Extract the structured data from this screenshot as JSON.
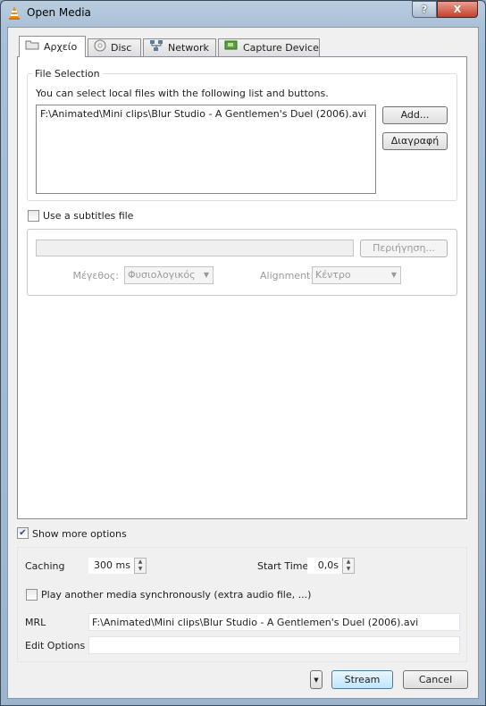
{
  "window": {
    "title": "Open Media",
    "help_label": "?",
    "close_label": "X"
  },
  "tabs": [
    {
      "label": "Αρχείο",
      "icon": "folder-icon"
    },
    {
      "label": "Disc",
      "icon": "disc-icon"
    },
    {
      "label": "Network",
      "icon": "network-icon"
    },
    {
      "label": "Capture Device",
      "icon": "capture-card-icon"
    }
  ],
  "file_selection": {
    "group_label": "File Selection",
    "description": "You can select local files with the following list and buttons.",
    "files": [
      "F:\\Animated\\Mini clips\\Blur Studio - A Gentlemen's Duel (2006).avi"
    ],
    "add_label": "Add...",
    "remove_label": "Διαγραφή"
  },
  "subtitles": {
    "checkbox_label": "Use a subtitles file",
    "checked": false,
    "browse_label": "Περιήγηση...",
    "size_label": "Μέγεθος:",
    "size_value": "Φυσιολογικός",
    "alignment_label": "Alignment:",
    "alignment_value": "Κέντρο"
  },
  "more_options": {
    "checkbox_label": "Show more options",
    "checked": true,
    "caching_label": "Caching",
    "caching_value": "300 ms",
    "start_time_label": "Start Time",
    "start_time_value": "0,0s",
    "sync_label": "Play another media synchronously (extra audio file, ...)",
    "sync_checked": false,
    "mrl_label": "MRL",
    "mrl_value": "F:\\Animated\\Mini clips\\Blur Studio - A Gentlemen's Duel (2006).avi",
    "edit_options_label": "Edit Options",
    "edit_options_value": ""
  },
  "footer": {
    "stream_label": "Stream",
    "cancel_label": "Cancel"
  }
}
